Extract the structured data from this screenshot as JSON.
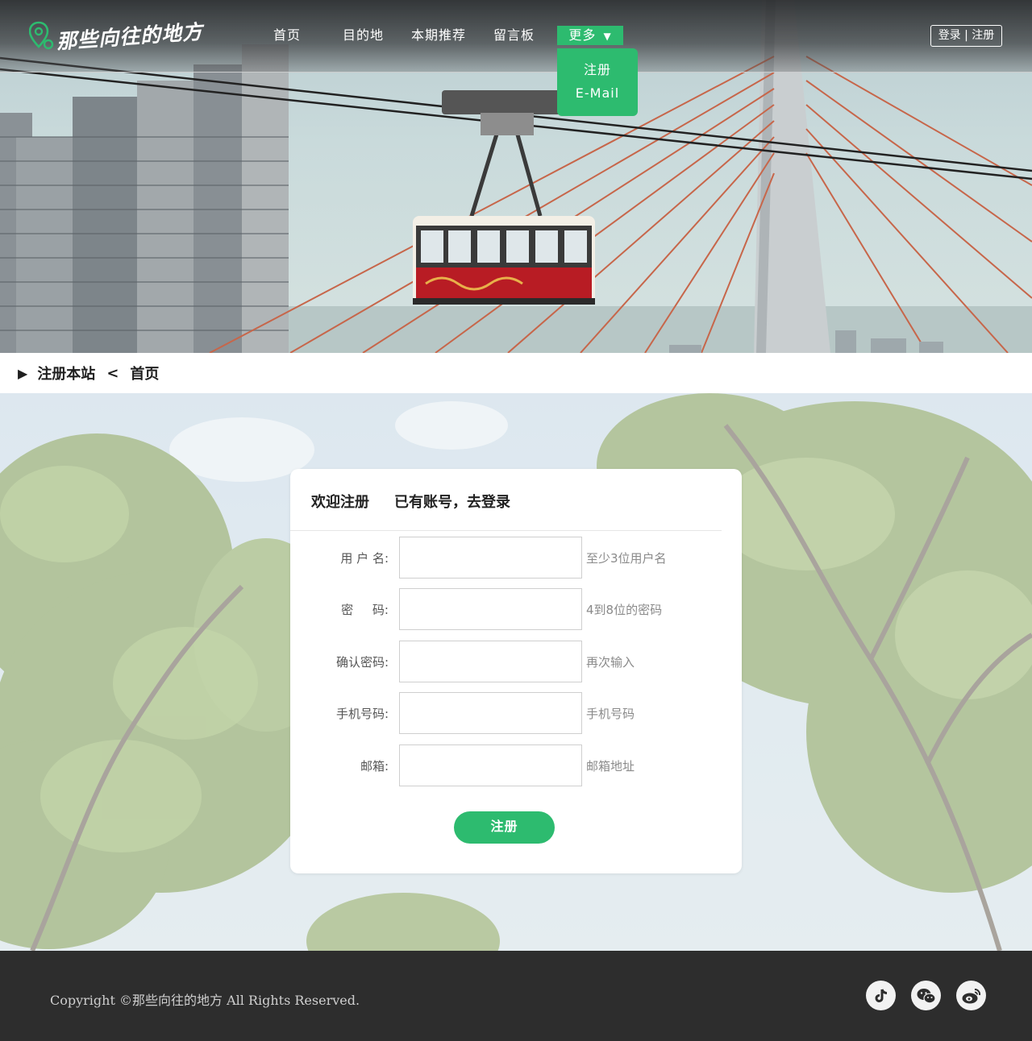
{
  "site": {
    "logo_text": "那些向往的地方"
  },
  "nav": {
    "items": [
      {
        "label": "首页"
      },
      {
        "label": "目的地"
      },
      {
        "label": "本期推荐"
      },
      {
        "label": "留言板"
      }
    ],
    "more_label": "更多",
    "more_icon": "caret-down-icon",
    "dropdown": [
      {
        "label": "注册"
      },
      {
        "label": "E-Mail"
      }
    ],
    "auth_label": "登录 | 注册"
  },
  "breadcrumb": {
    "current": "注册本站",
    "separator": "<",
    "home": "首页"
  },
  "form": {
    "tab_register": "欢迎注册",
    "tab_login": "已有账号，去登录",
    "fields": [
      {
        "label": "用 户 名:",
        "value": "",
        "hint": "至少3位用户名"
      },
      {
        "label": "密     码:",
        "value": "",
        "hint": "4到8位的密码"
      },
      {
        "label": "确认密码:",
        "value": "",
        "hint": "再次输入"
      },
      {
        "label": "手机号码:",
        "value": "",
        "hint": "手机号码"
      },
      {
        "label": "邮箱:",
        "value": "",
        "hint": "邮箱地址"
      }
    ],
    "submit_label": "注册"
  },
  "footer": {
    "copyright": "Copyright ©那些向往的地方 All Rights Reserved.",
    "social": [
      "tiktok-icon",
      "wechat-icon",
      "weibo-icon"
    ]
  },
  "colors": {
    "accent": "#2dbb6f",
    "footer_bg": "#2d2d2d"
  }
}
